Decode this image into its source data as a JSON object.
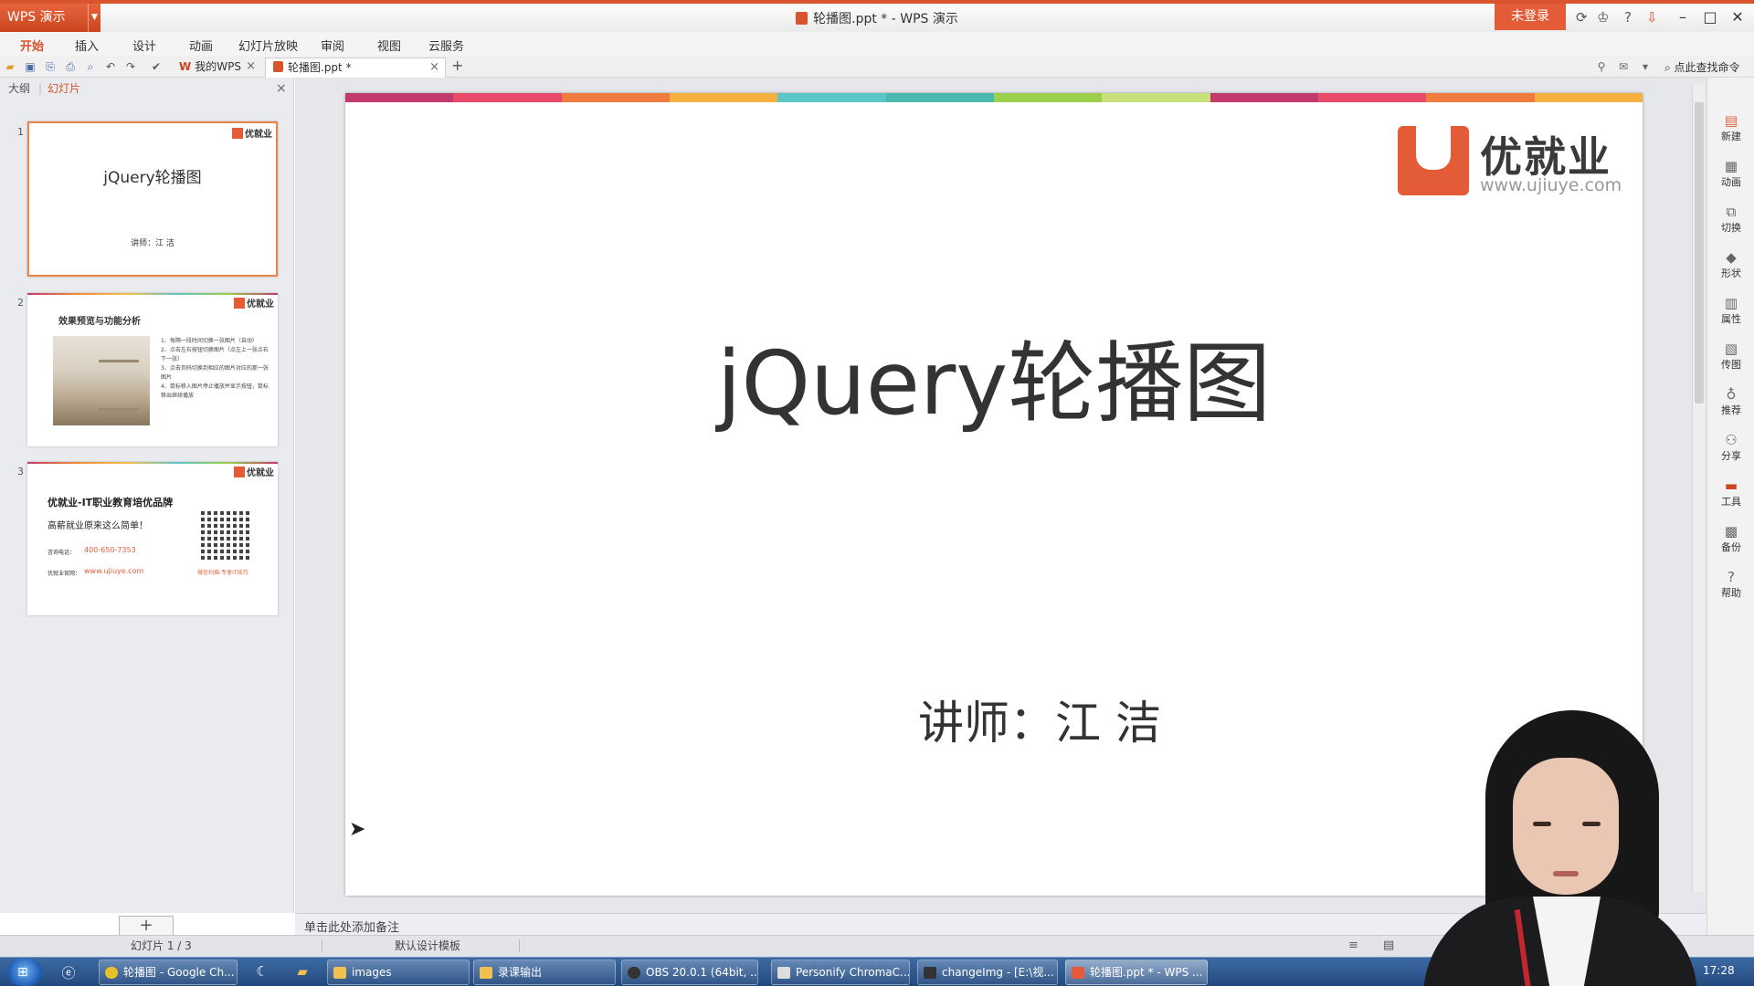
{
  "app": {
    "menu_button": "WPS 演示",
    "window_title": "轮播图.ppt * - WPS 演示",
    "login_button": "未登录",
    "help_label": "?"
  },
  "menu": [
    "开始",
    "插入",
    "设计",
    "动画",
    "幻灯片放映",
    "审阅",
    "视图",
    "云服务"
  ],
  "tabs": {
    "wps_tab": "我的WPS",
    "doc_tab": "轮播图.ppt *",
    "add": "+",
    "search_cmd": "点此查找命令"
  },
  "left_pane": {
    "outline_tab": "大纲",
    "slides_tab": "幻灯片",
    "close": "×",
    "add_slide": "+"
  },
  "thumbnails": {
    "logo_name": "优就业",
    "slide1": {
      "num": "1",
      "title": "jQuery轮播图",
      "subtitle": "讲师：江 洁"
    },
    "slide2": {
      "num": "2",
      "title": "效果预览与功能分析",
      "lines": [
        "1、每隔一段时间切换一张图片（自动）",
        "2、点击左右按钮切换图片（点左上一张点右下一张）",
        "3、点击页码切换到相应的图片对应的那一张图片",
        "4、鼠标移入图片停止播放并显示按钮，鼠标移出继续播放"
      ]
    },
    "slide3": {
      "num": "3",
      "brand": "优就业-IT职业教育培优品牌",
      "slogan": "高薪就业原来这么简单！",
      "phone_label": "咨询电话：",
      "phone": "400-650-7353",
      "site_label": "优就业官网：",
      "site": "www.ujiuye.com",
      "qr_caption": "微信扫描-专享IT技巧"
    }
  },
  "slide": {
    "logo_name": "优就业",
    "logo_url": "www.ujiuye.com",
    "title": "jQuery轮播图",
    "subtitle": "讲师：江 洁",
    "stripe_colors": [
      "#c23a6b",
      "#e94a6a",
      "#f07b3f",
      "#f5b041",
      "#5cc5c8",
      "#4bb8b0",
      "#9ccf4a",
      "#c8e07a",
      "#c23a6b",
      "#e94a6a",
      "#f07b3f",
      "#f5b041"
    ]
  },
  "notes": {
    "placeholder": "单击此处添加备注"
  },
  "right_bar": [
    {
      "label": "新建",
      "icon": "new-file-icon"
    },
    {
      "label": "动画",
      "icon": "animation-icon"
    },
    {
      "label": "切换",
      "icon": "transition-icon"
    },
    {
      "label": "形状",
      "icon": "shape-icon"
    },
    {
      "label": "属性",
      "icon": "properties-icon"
    },
    {
      "label": "传图",
      "icon": "upload-image-icon"
    },
    {
      "label": "推荐",
      "icon": "recommend-icon"
    },
    {
      "label": "分享",
      "icon": "share-icon"
    },
    {
      "label": "工具",
      "icon": "toolbox-icon"
    },
    {
      "label": "备份",
      "icon": "backup-icon"
    },
    {
      "label": "帮助",
      "icon": "help-icon"
    }
  ],
  "status": {
    "slide_counter": "幻灯片 1 / 3",
    "template": "默认设计模板"
  },
  "taskbar": {
    "items": [
      "轮播图 - Google Ch...",
      "images",
      "录课输出",
      "OBS 20.0.1 (64bit, ...",
      "Personify ChromaC...",
      "changeImg - [E:\\视...",
      "轮播图.ppt * - WPS ..."
    ],
    "clock": "17:28"
  },
  "colors": {
    "accent": "#d9542c",
    "brand": "#e35c37"
  }
}
